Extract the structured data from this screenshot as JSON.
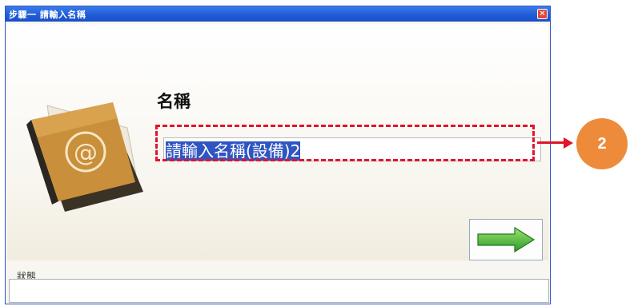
{
  "window": {
    "title": "步驟一 請輸入名稱",
    "close_symbol": "✕"
  },
  "form": {
    "name_label": "名稱",
    "name_value": "請輸入名稱(設備)2",
    "next_icon": "right-arrow-icon"
  },
  "status": {
    "label": "狀態",
    "value": ""
  },
  "callout": {
    "number": "2",
    "color": "#ee8b3a",
    "highlight_color": "#e0142a"
  }
}
